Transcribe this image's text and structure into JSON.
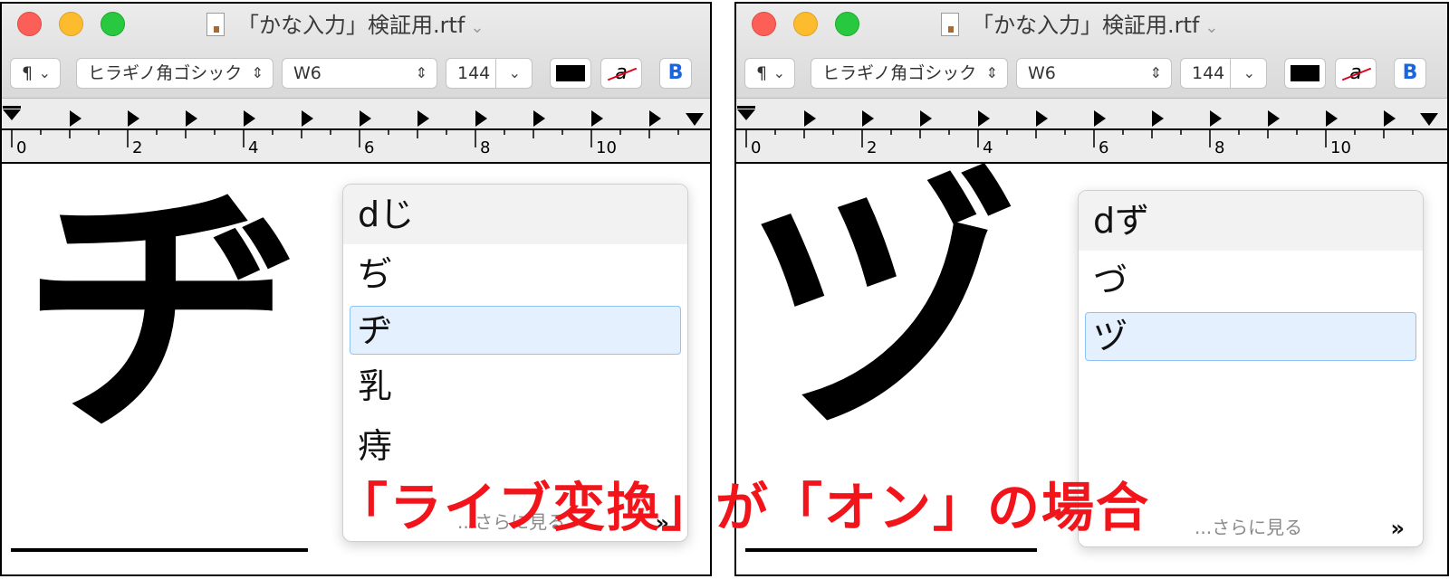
{
  "caption": "「ライブ変換」が「オン」の場合",
  "windows": [
    {
      "title": "「かな入力」検証用.rtf",
      "toolbar": {
        "paragraph": "¶",
        "font": "ヒラギノ角ゴシック",
        "weight": "W6",
        "size": "144",
        "bold": "B",
        "text_color": "#000000",
        "highlight_glyph": "a"
      },
      "ruler": {
        "labels": [
          "0",
          "2",
          "4",
          "6",
          "8",
          "10"
        ]
      },
      "big_char": "ヂ",
      "popup": {
        "typed": "dじ",
        "candidates": [
          "ぢ",
          "ヂ",
          "乳",
          "痔"
        ],
        "selected_index": 1,
        "more": "...さらに見る",
        "more_arrow": "»"
      }
    },
    {
      "title": "「かな入力」検証用.rtf",
      "toolbar": {
        "paragraph": "¶",
        "font": "ヒラギノ角ゴシック",
        "weight": "W6",
        "size": "144",
        "bold": "B",
        "text_color": "#000000",
        "highlight_glyph": "a"
      },
      "ruler": {
        "labels": [
          "0",
          "2",
          "4",
          "6",
          "8",
          "10"
        ]
      },
      "big_char": "ヅ",
      "popup": {
        "typed": "dず",
        "candidates": [
          "づ",
          "ヅ"
        ],
        "selected_index": 1,
        "more": "...さらに見る",
        "more_arrow": "»"
      }
    }
  ],
  "colors": {
    "caption": "#f2141b",
    "selection_bg": "#e4f0fd",
    "selection_border": "#8fc2f5"
  }
}
